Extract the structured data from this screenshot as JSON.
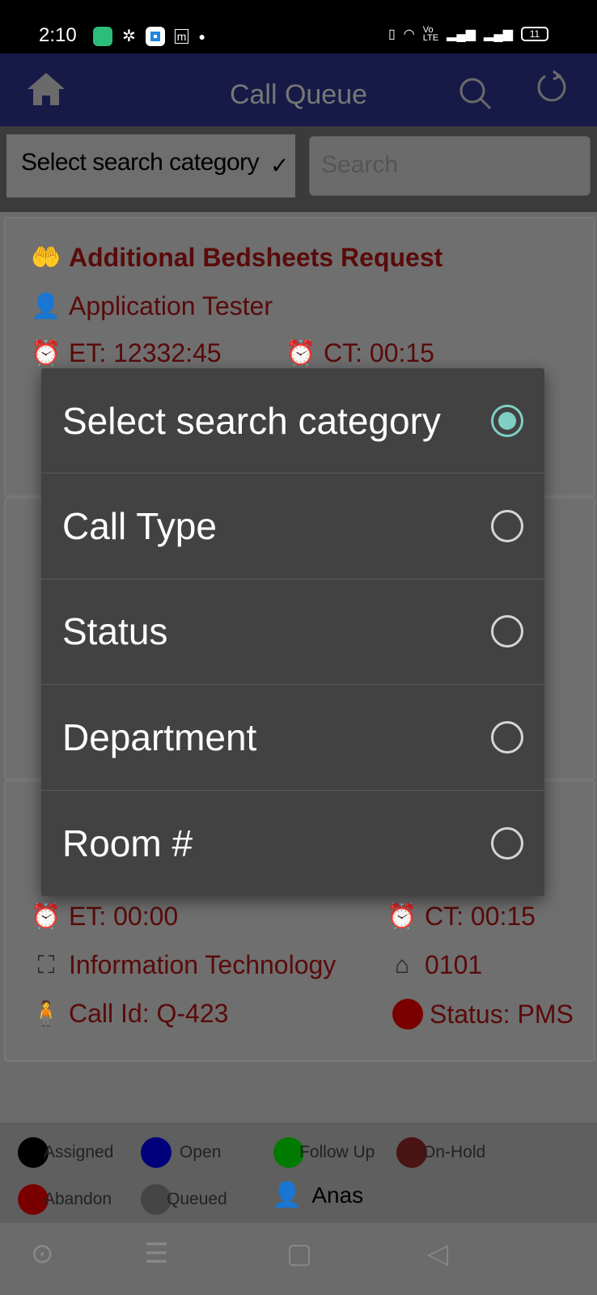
{
  "status_bar": {
    "time": "2:10",
    "battery": "11"
  },
  "header": {
    "title": "Call Queue",
    "icons": [
      "home-icon",
      "search-icon",
      "refresh-icon"
    ]
  },
  "search": {
    "category_selected": "Select search category",
    "placeholder": "Search"
  },
  "cards": [
    {
      "call_type": "Additional Bedsheets Request",
      "user": "Application Tester",
      "et": "ET: 12332:45",
      "ct": "CT: 00:15"
    },
    {},
    {
      "et": "ET: 00:00",
      "ct": "CT: 00:15",
      "department": "Information Technology",
      "room": "0101",
      "call_id": "Call Id: Q-423",
      "status": "Status: PMS",
      "status_color": "#7a0000"
    }
  ],
  "legend": {
    "items": [
      {
        "label": "Assigned",
        "color": "#000000"
      },
      {
        "label": "Open",
        "color": "#00007a"
      },
      {
        "label": "Follow Up",
        "color": "#007a00"
      },
      {
        "label": "On-Hold",
        "color": "#4a1414"
      },
      {
        "label": "Abandon",
        "color": "#7a0000"
      },
      {
        "label": "Queued",
        "color": "#454545"
      }
    ],
    "user": "Anas"
  },
  "dialog": {
    "options": [
      {
        "label": "Select search category",
        "selected": true
      },
      {
        "label": "Call Type",
        "selected": false
      },
      {
        "label": "Status",
        "selected": false
      },
      {
        "label": "Department",
        "selected": false
      },
      {
        "label": "Room #",
        "selected": false
      }
    ],
    "accent": "#7fcfc4"
  }
}
